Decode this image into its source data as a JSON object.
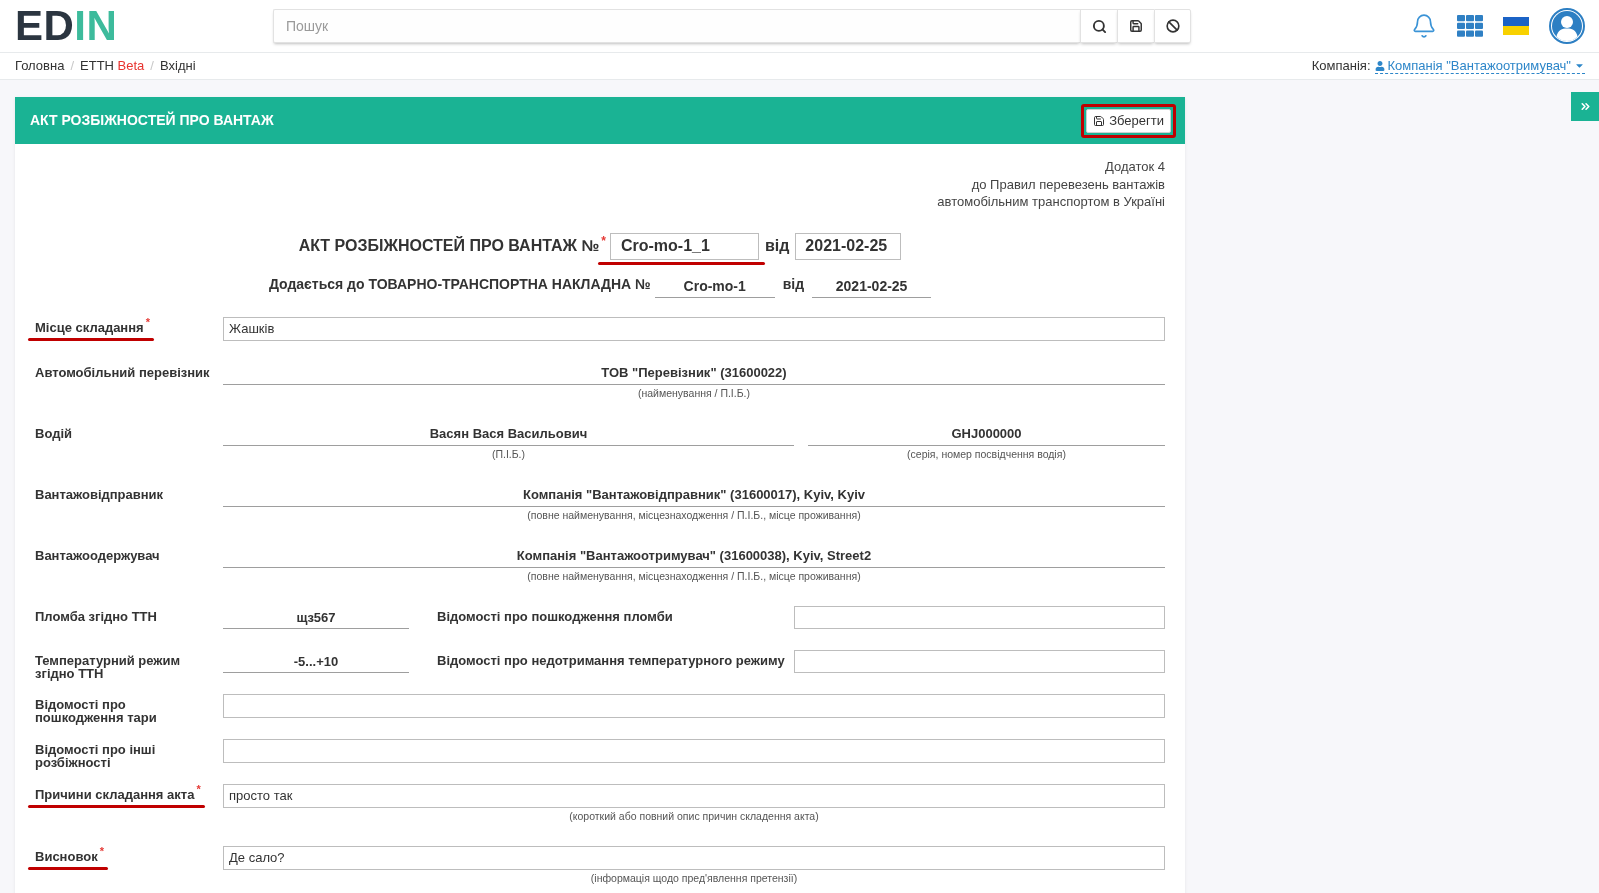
{
  "header": {
    "logo": {
      "primary": "ED",
      "accent": "IN"
    },
    "search": {
      "placeholder": "Пошук"
    }
  },
  "breadcrumbs": [
    {
      "label": "Головна"
    },
    {
      "separator_before": "/",
      "label": "ЕТТН",
      "badge": "Beta"
    },
    {
      "separator_before": "/",
      "label": "Вхідні"
    }
  ],
  "company": {
    "label": "Компанія:",
    "value": "Компанія \"Вантажоотримувач\""
  },
  "panel": {
    "title": "АКТ РОЗБІЖНОСТЕЙ ПРО ВАНТАЖ",
    "save_button": {
      "label": "Зберегти",
      "highlighted": true
    }
  },
  "appendix": [
    "Додаток 4",
    "до Правил перевезень вантажів",
    "автомобільним транспортом в Україні"
  ],
  "act": {
    "title": "АКТ РОЗБІЖНОСТЕЙ ПРО ВАНТАЖ №$^{*}$",
    "number": "Cro-mo-1_1",
    "number_highlighted": true,
    "date_label": "від",
    "date": "2021-02-25"
  },
  "waybill": {
    "title": "Додається до ТОВАРНО-ТРАНСПОРТНА НАКЛАДНА №",
    "number": "Cro-mo-1",
    "date_label": "від",
    "date": "2021-02-25"
  },
  "rows": [
    {
      "kind": "input",
      "label": "Місце складання$^{*}$",
      "highlighted": true,
      "value": "Жашків"
    },
    {
      "kind": "line",
      "label": "Автомобільний перевізник",
      "highlighted": false,
      "values": [
        {
          "value": "ТОВ \"Перевізник\" (31600022)",
          "caption": "(найменування / П.І.Б.)"
        }
      ]
    },
    {
      "kind": "line",
      "label": "Водій",
      "highlighted": false,
      "values": [
        {
          "value": "Васян Вася Васильович",
          "caption": "(П.І.Б.)"
        },
        {
          "value": "GHJ000000",
          "caption": "(серія, номер посвідчення водія)"
        }
      ]
    },
    {
      "kind": "line",
      "label": "Вантажовідправник",
      "highlighted": false,
      "values": [
        {
          "value": "Компанія \"Вантажовідправник\" (31600017), Kyiv, Kyiv",
          "caption": "(повне найменування, місцезнаходження / П.І.Б., місце проживання)"
        }
      ]
    },
    {
      "kind": "line",
      "label": "Вантажоодержувач",
      "highlighted": false,
      "values": [
        {
          "value": "Компанія \"Вантажоотримувач\" (31600038), Kyiv, Street2",
          "caption": "(повне найменування, місцезнаходження / П.І.Б., місце проживання)"
        }
      ]
    },
    {
      "kind": "pair",
      "label": "Пломба згідно ТТН",
      "highlighted": false,
      "value": "щз567",
      "side_label": "Відомості про пошкодження пломби"
    },
    {
      "kind": "pair",
      "label": "Температурний режим згідно ТТН",
      "highlighted": false,
      "value": "-5...+10",
      "side_label": "Відомості про недотримання температурного режиму"
    },
    {
      "kind": "input",
      "label": "Відомості про пошкодження тари",
      "highlighted": false
    },
    {
      "kind": "input",
      "label": "Відомості про інші розбіжності",
      "highlighted": false
    },
    {
      "kind": "input",
      "label": "Причини складання акта$^{*}$",
      "highlighted": true,
      "value": "просто так",
      "caption": "(короткий або повний опис причин складення акта)"
    },
    {
      "kind": "input",
      "label": "Висновок$^{*}$",
      "highlighted": true,
      "value": "Де сало?",
      "caption": "(інформація щодо пред'явлення претензії)"
    }
  ]
}
